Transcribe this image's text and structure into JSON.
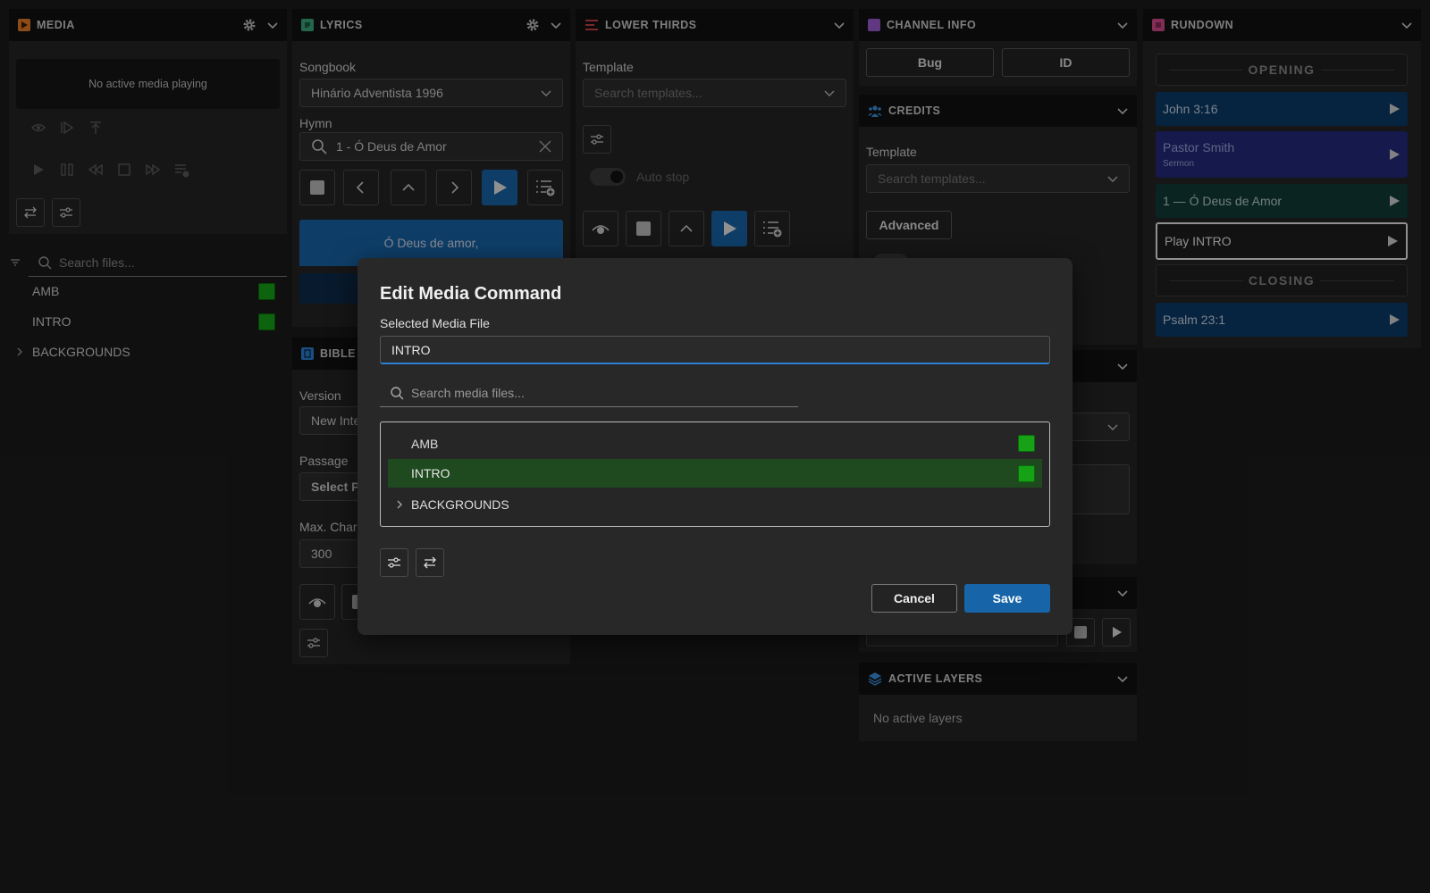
{
  "media": {
    "title": "MEDIA",
    "status": "No active media playing",
    "search_placeholder": "Search files...",
    "files": [
      {
        "name": "AMB"
      },
      {
        "name": "INTRO"
      }
    ],
    "folder": "BACKGROUNDS"
  },
  "lyrics": {
    "title": "LYRICS",
    "songbook_label": "Songbook",
    "songbook_value": "Hinário Adventista 1996",
    "hymn_label": "Hymn",
    "hymn_value": "1 - Ó Deus de Amor",
    "current_line": "Ó Deus de amor,"
  },
  "bible": {
    "title": "BIBLE",
    "version_label": "Version",
    "version_value": "New Inte",
    "passage_label": "Passage",
    "passage_value": "Select P",
    "maxchar_label": "Max. Char",
    "maxchar_value": "300"
  },
  "lower_thirds": {
    "title": "LOWER THIRDS",
    "template_label": "Template",
    "template_placeholder": "Search templates...",
    "autostop_label": "Auto stop"
  },
  "channel_info": {
    "title": "CHANNEL INFO",
    "bug_label": "Bug",
    "id_label": "ID"
  },
  "credits": {
    "title": "CREDITS",
    "template_label": "Template",
    "template_placeholder": "Search templates...",
    "advanced_label": "Advanced"
  },
  "active_layers": {
    "title": "ACTIVE LAYERS",
    "empty": "No active layers"
  },
  "rundown": {
    "title": "RUNDOWN",
    "sections": {
      "opening": "OPENING",
      "closing": "CLOSING"
    },
    "items": [
      {
        "title": "John 3:16",
        "sub": "",
        "color": "#0b3a66"
      },
      {
        "title": "Pastor Smith",
        "sub": "Sermon",
        "color": "#22297a"
      },
      {
        "title": "1 — Ó Deus de Amor",
        "sub": "",
        "color": "#0f3a36"
      },
      {
        "title": "Play INTRO",
        "sub": "",
        "color": "#1e1e1e"
      },
      {
        "title": "Psalm 23:1",
        "sub": "",
        "color": "#0b3a66"
      }
    ]
  },
  "modal": {
    "title": "Edit Media Command",
    "selected_label": "Selected Media File",
    "selected_value": "INTRO",
    "search_placeholder": "Search media files...",
    "files": [
      {
        "name": "AMB"
      },
      {
        "name": "INTRO"
      }
    ],
    "folder": "BACKGROUNDS",
    "cancel_label": "Cancel",
    "save_label": "Save"
  },
  "colors": {
    "accent": "#1765a8",
    "green": "#17a117",
    "selected_row": "#1f4a1f"
  }
}
